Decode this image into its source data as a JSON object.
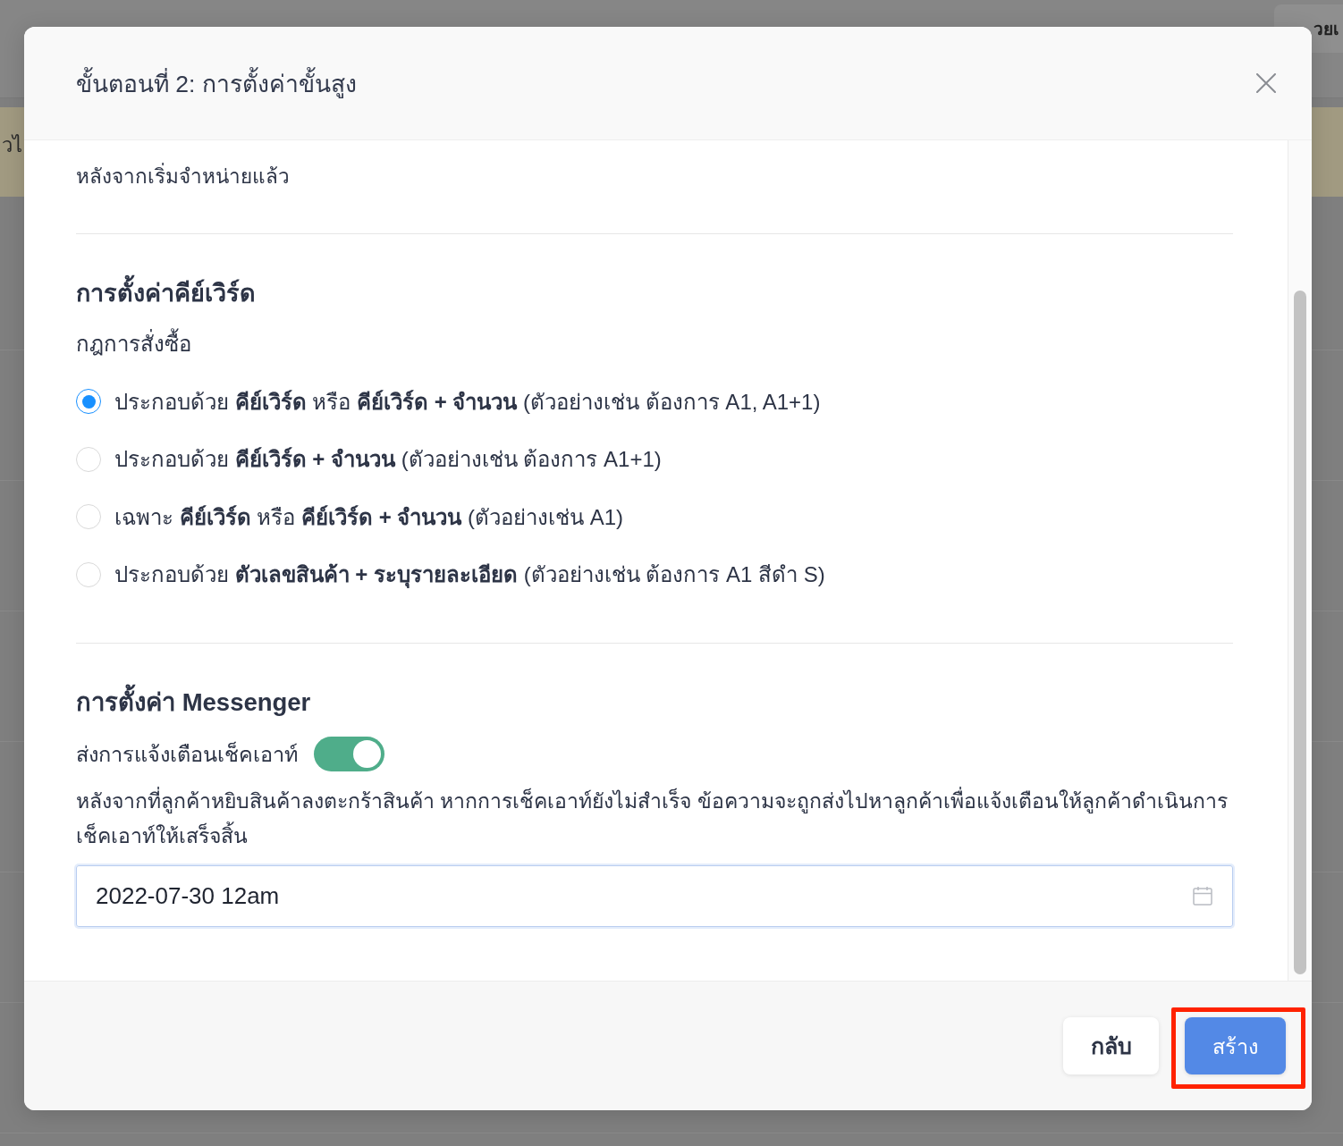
{
  "background": {
    "help_button": "วยเ",
    "banner_text": "วไ"
  },
  "dialog": {
    "title": "ขั้นตอนที่ 2: การตั้งค่าขั้นสูง"
  },
  "intro": {
    "text": "หลังจากเริ่มจำหน่ายแล้ว"
  },
  "keyword_settings": {
    "title": "การตั้งค่าคีย์เวิร์ด",
    "rule_label": "กฎการสั่งซื้อ",
    "options": [
      {
        "label": "ประกอบด้วย **คีย์เวิร์ด** หรือ **คีย์เวิร์ด + จำนวน** (ตัวอย่างเช่น ต้องการ A1, A1+1)",
        "selected": true
      },
      {
        "label": "ประกอบด้วย **คีย์เวิร์ด + จำนวน** (ตัวอย่างเช่น ต้องการ A1+1)",
        "selected": false
      },
      {
        "label": "เฉพาะ **คีย์เวิร์ด** หรือ **คีย์เวิร์ด + จำนวน** (ตัวอย่างเช่น A1)",
        "selected": false
      },
      {
        "label": "ประกอบด้วย **ตัวเลขสินค้า + ระบุรายละเอียด** (ตัวอย่างเช่น ต้องการ A1 สีดำ S)",
        "selected": false
      }
    ]
  },
  "messenger_settings": {
    "title": "การตั้งค่า Messenger",
    "reminder": {
      "label": "ส่งการแจ้งเตือนเช็คเอาท์",
      "on": true
    },
    "description": "หลังจากที่ลูกค้าหยิบสินค้าลงตะกร้าสินค้า หากการเช็คเอาท์ยังไม่สำเร็จ ข้อความจะถูกส่งไปหาลูกค้าเพื่อแจ้งเตือนให้ลูกค้าดำเนินการเช็คเอาท์ให้เสร็จสิ้น",
    "date_field": {
      "value": "2022-07-30 12am"
    }
  },
  "footer": {
    "buttons": [
      {
        "label": "กลับ",
        "kind": "secondary",
        "highlighted": false
      },
      {
        "label": "สร้าง",
        "kind": "primary",
        "highlighted": true
      }
    ]
  }
}
